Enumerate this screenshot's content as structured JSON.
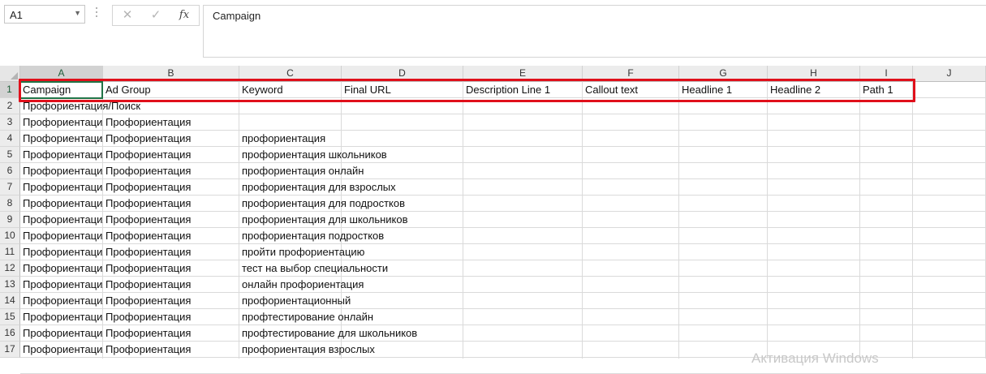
{
  "namebox": {
    "value": "A1",
    "dropdown_icon": "chevron-down-icon"
  },
  "formula_bar": {
    "cancel_icon": "close-icon",
    "enter_icon": "check-icon",
    "function_label": "fx",
    "value": "Campaign"
  },
  "columns": [
    "A",
    "B",
    "C",
    "D",
    "E",
    "F",
    "G",
    "H",
    "I",
    "J"
  ],
  "rows": [
    "1",
    "2",
    "3",
    "4",
    "5",
    "6",
    "7",
    "8",
    "9",
    "10",
    "11",
    "12",
    "13",
    "14",
    "15",
    "16",
    "17"
  ],
  "headers": [
    "Campaign",
    "Ad Group",
    "Keyword",
    "Final URL",
    "Description Line 1",
    "Callout text",
    "Headline 1",
    "Headline 2",
    "Path 1"
  ],
  "data_rows": [
    [
      "Профориентация/Поиск",
      "",
      ""
    ],
    [
      "Профориентация/Поиск",
      "Профориентация",
      ""
    ],
    [
      "Профориентация/Поиск",
      "Профориентация",
      "профориентация"
    ],
    [
      "Профориентация/Поиск",
      "Профориентация",
      "профориентация школьников"
    ],
    [
      "Профориентация/Поиск",
      "Профориентация",
      "профориентация онлайн"
    ],
    [
      "Профориентация/Поиск",
      "Профориентация",
      "профориентация для взрослых"
    ],
    [
      "Профориентация/Поиск",
      "Профориентация",
      "профориентация для подростков"
    ],
    [
      "Профориентация/Поиск",
      "Профориентация",
      "профориентация для школьников"
    ],
    [
      "Профориентация/Поиск",
      "Профориентация",
      "профориентация подростков"
    ],
    [
      "Профориентация/Поиск",
      "Профориентация",
      "пройти профориентацию"
    ],
    [
      "Профориентация/Поиск",
      "Профориентация",
      "тест на выбор специальности"
    ],
    [
      "Профориентация/Поиск",
      "Профориентация",
      "онлайн профориентация"
    ],
    [
      "Профориентация/Поиск",
      "Профориентация",
      "профориентационный"
    ],
    [
      "Профориентация/Поиск",
      "Профориентация",
      "профтестирование онлайн"
    ],
    [
      "Профориентация/Поиск",
      "Профориентация",
      "профтестирование для школьников"
    ],
    [
      "Профориентация/Поиск",
      "Профориентация",
      "профориентация взрослых"
    ]
  ],
  "watermark": "Активация Windows",
  "accent_color": "#217346",
  "annotation_color": "#e0101b"
}
